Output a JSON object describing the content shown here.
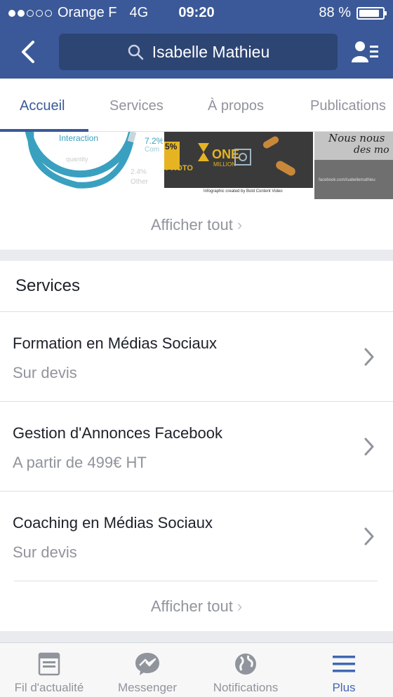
{
  "status_bar": {
    "carrier": "Orange F",
    "network": "4G",
    "time": "09:20",
    "battery": "88 %",
    "battery_level": 0.88,
    "signal_bars": 2
  },
  "nav": {
    "search_text": "Isabelle Mathieu",
    "back_icon": "back-chevron-icon",
    "friend_icon": "friend-list-icon"
  },
  "tabs": [
    {
      "label": "Accueil",
      "active": true
    },
    {
      "label": "Services",
      "active": false
    },
    {
      "label": "À propos",
      "active": false
    },
    {
      "label": "Publications",
      "active": false
    }
  ],
  "photos": {
    "thumb1": {
      "label": "Interaction",
      "sub": "quantity",
      "pct1": "7.2%",
      "pct1_sub": "Com",
      "pct2": "2.4%",
      "pct2_sub": "Other"
    },
    "thumb2": {
      "big": "ONE",
      "big2": "MILLION",
      "left": "5%",
      "photo": "PHOTO",
      "credit": "Infographic created by Bold Content Video"
    },
    "thumb3": {
      "quote": "Nous nous",
      "quote2": "des mo",
      "caption": "facebook.com/isabellemathieu"
    },
    "show_all": "Afficher tout"
  },
  "services": {
    "title": "Services",
    "items": [
      {
        "name": "Formation en Médias Sociaux",
        "price": "Sur devis"
      },
      {
        "name": "Gestion d'Annonces Facebook",
        "price": "A partir de 499€ HT"
      },
      {
        "name": "Coaching en Médias Sociaux",
        "price": "Sur devis"
      }
    ],
    "show_all": "Afficher tout"
  },
  "bottom_tabs": [
    {
      "label": "Fil d'actualité",
      "icon": "news-feed-icon",
      "active": false
    },
    {
      "label": "Messenger",
      "icon": "messenger-icon",
      "active": false
    },
    {
      "label": "Notifications",
      "icon": "globe-icon",
      "active": false
    },
    {
      "label": "Plus",
      "icon": "menu-icon",
      "active": true
    }
  ],
  "colors": {
    "brand": "#3b5998",
    "search_bg": "#2d4573",
    "active_tab": "#4267b2",
    "muted": "#90949c"
  }
}
